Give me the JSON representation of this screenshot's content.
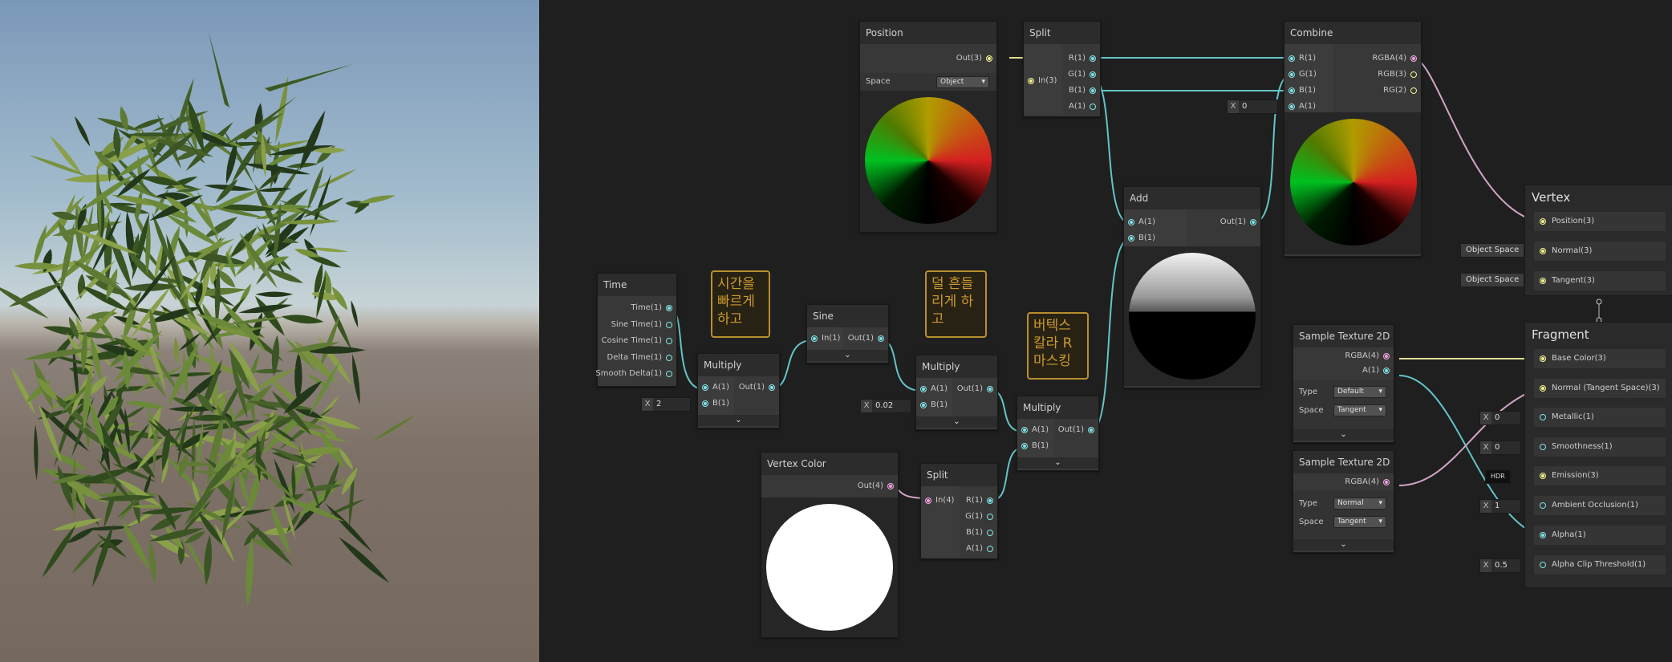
{
  "nodes": {
    "position": {
      "title": "Position",
      "out": "Out(3)",
      "space_label": "Space",
      "space_value": "Object"
    },
    "split_top": {
      "title": "Split",
      "in": "In(3)",
      "outs": [
        "R(1)",
        "G(1)",
        "B(1)",
        "A(1)"
      ]
    },
    "combine": {
      "title": "Combine",
      "ins": [
        "R(1)",
        "G(1)",
        "B(1)",
        "A(1)"
      ],
      "outs": [
        "RGBA(4)",
        "RGB(3)",
        "RG(2)"
      ],
      "a_default_x": "X",
      "a_default": "0"
    },
    "add": {
      "title": "Add",
      "ins": [
        "A(1)",
        "B(1)"
      ],
      "out": "Out(1)"
    },
    "time": {
      "title": "Time",
      "outs": [
        "Time(1)",
        "Sine Time(1)",
        "Cosine Time(1)",
        "Delta Time(1)",
        "Smooth Delta(1)"
      ]
    },
    "multiply1": {
      "title": "Multiply",
      "ins": [
        "A(1)",
        "B(1)"
      ],
      "out": "Out(1)",
      "b_default_x": "X",
      "b_default": "2"
    },
    "sine": {
      "title": "Sine",
      "in": "In(1)",
      "out": "Out(1)"
    },
    "multiply2": {
      "title": "Multiply",
      "ins": [
        "A(1)",
        "B(1)"
      ],
      "out": "Out(1)",
      "b_default_x": "X",
      "b_default": "0.02"
    },
    "multiply3": {
      "title": "Multiply",
      "ins": [
        "A(1)",
        "B(1)"
      ],
      "out": "Out(1)"
    },
    "vertex_color": {
      "title": "Vertex Color",
      "out": "Out(4)"
    },
    "split_bottom": {
      "title": "Split",
      "in": "In(4)",
      "outs": [
        "R(1)",
        "G(1)",
        "B(1)",
        "A(1)"
      ]
    },
    "sample1": {
      "title": "Sample Texture 2D",
      "outs": [
        "RGBA(4)",
        "A(1)"
      ],
      "type_label": "Type",
      "type_value": "Default",
      "space_label": "Space",
      "space_value": "Tangent"
    },
    "sample2": {
      "title": "Sample Texture 2D",
      "outs": [
        "RGBA(4)"
      ],
      "type_label": "Type",
      "type_value": "Normal",
      "space_label": "Space",
      "space_value": "Tangent"
    }
  },
  "stickies": {
    "note1": "시간을\n빠르게\n하고",
    "note2": "덜 흔들\n리게 하\n고",
    "note3": "버텍스\n칼라 R\n마스킹"
  },
  "vertex": {
    "title": "Vertex",
    "rows": [
      "Position(3)",
      "Normal(3)",
      "Tangent(3)"
    ],
    "normal_space": "Object Space",
    "tangent_space": "Object Space"
  },
  "fragment": {
    "title": "Fragment",
    "rows": [
      "Base Color(3)",
      "Normal (Tangent Space)(3)",
      "Metallic(1)",
      "Smoothness(1)",
      "Emission(3)",
      "Ambient Occlusion(1)",
      "Alpha(1)",
      "Alpha Clip Threshold(1)"
    ],
    "metallic_x": "X",
    "metallic": "0",
    "smoothness_x": "X",
    "smoothness": "0",
    "emission": "HDR",
    "ao_x": "X",
    "ao": "1",
    "clip_x": "X",
    "clip": "0.5"
  },
  "colors": {
    "float_port": "#84e4e7",
    "vec3_port": "#f3f393",
    "vec4_port": "#f3a5e2",
    "sticky_border": "#b78f30"
  }
}
